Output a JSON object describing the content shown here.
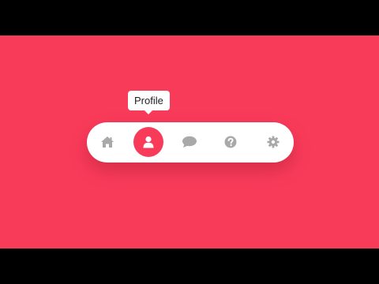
{
  "tooltip": {
    "text": "Profile"
  },
  "nav": {
    "items": [
      {
        "name": "home",
        "icon": "home-icon"
      },
      {
        "name": "profile",
        "icon": "user-icon",
        "active": true
      },
      {
        "name": "messages",
        "icon": "chat-bubble-icon"
      },
      {
        "name": "help",
        "icon": "question-circle-icon"
      },
      {
        "name": "settings",
        "icon": "gear-icon"
      }
    ]
  },
  "colors": {
    "background": "#f93b5a",
    "letterbox": "#000000",
    "navbar": "#ffffff",
    "icon_inactive": "#a9a9a9",
    "icon_active": "#ffffff",
    "active_bg": "#f93b5a"
  }
}
